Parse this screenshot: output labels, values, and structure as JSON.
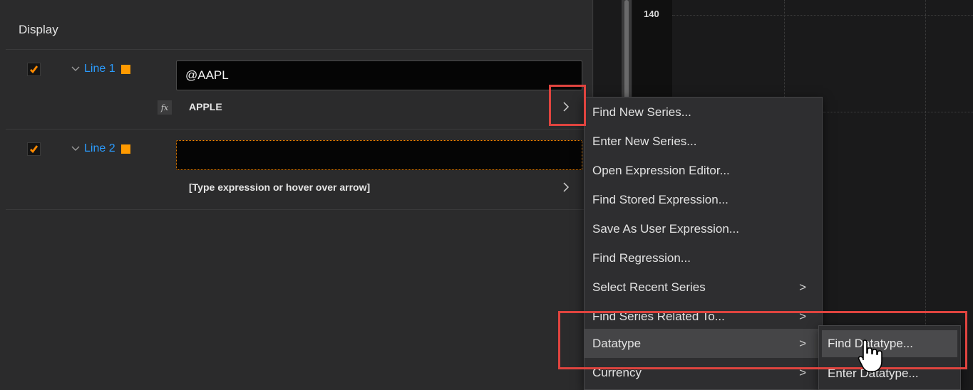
{
  "panel": {
    "title": "Display"
  },
  "lines": [
    {
      "label": "Line 1",
      "checked": true,
      "swatch_color": "#ff9a00",
      "input_value": "@AAPL",
      "description": "APPLE",
      "fx_label": "fx"
    },
    {
      "label": "Line 2",
      "checked": true,
      "swatch_color": "#ff9a00",
      "input_value": "",
      "description": "[Type expression or hover over arrow]"
    }
  ],
  "chart": {
    "y_tick": "140"
  },
  "context_menu": {
    "items": [
      {
        "label": "Find New Series...",
        "has_submenu": false
      },
      {
        "label": "Enter New Series...",
        "has_submenu": false
      },
      {
        "label": "Open Expression Editor...",
        "has_submenu": false
      },
      {
        "label": "Find Stored Expression...",
        "has_submenu": false
      },
      {
        "label": "Save As User Expression...",
        "has_submenu": false
      },
      {
        "label": "Find Regression...",
        "has_submenu": false
      },
      {
        "label": "Select Recent Series",
        "has_submenu": true
      },
      {
        "label": "Find Series Related To...",
        "has_submenu": true
      },
      {
        "label": "Datatype",
        "has_submenu": true,
        "active": true
      },
      {
        "label": "Currency",
        "has_submenu": true
      }
    ],
    "chevron": ">"
  },
  "submenu": {
    "items": [
      {
        "label": "Find Datatype...",
        "active": true
      },
      {
        "label": "Enter Datatype..."
      }
    ]
  },
  "colors": {
    "accent_blue": "#2b9cff",
    "accent_orange": "#ff9a00",
    "highlight_red": "#e0443f"
  }
}
